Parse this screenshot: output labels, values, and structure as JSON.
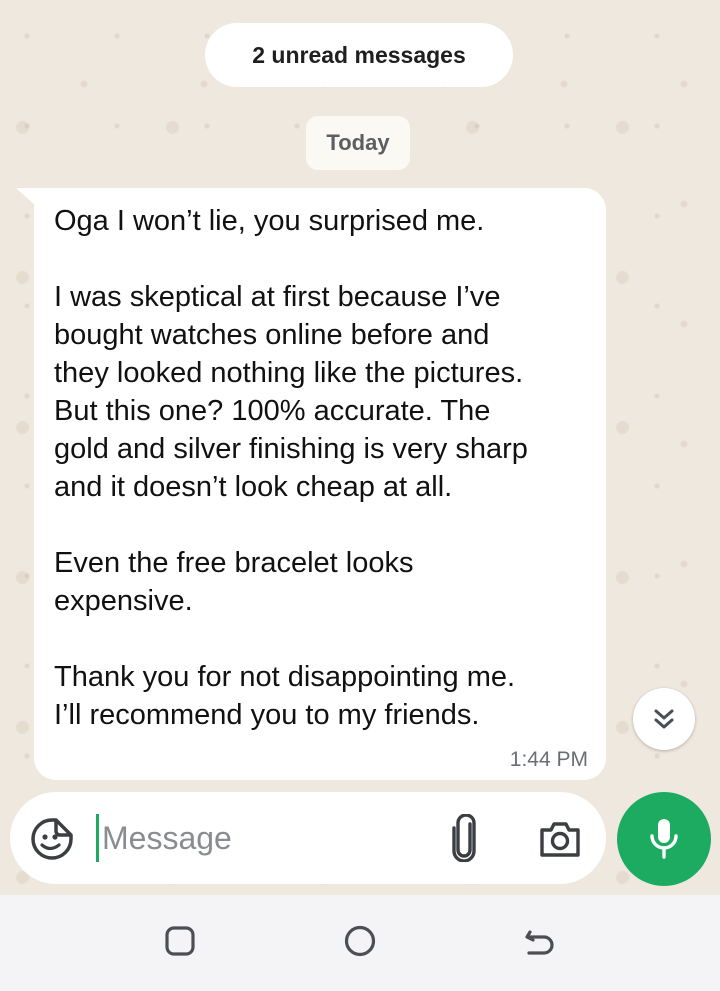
{
  "chat": {
    "unread_label": "2 unread messages",
    "date_label": "Today",
    "message": {
      "paragraphs": [
        "Oga I won’t lie, you surprised me.",
        "I was skeptical at first because I’ve\nbought watches online before and\nthey looked nothing like the pictures.\nBut this one? 100% accurate. The\ngold and silver finishing is very sharp\nand it doesn’t look cheap at all.",
        "Even the free bracelet looks\nexpensive.",
        "Thank you for not disappointing me.\nI’ll recommend you to my friends."
      ],
      "time": "1:44 PM"
    }
  },
  "composer": {
    "placeholder": "Message",
    "value": ""
  },
  "icons": {
    "scroll_down": "double-chevron-down-icon",
    "sticker": "sticker-icon",
    "attach": "paperclip-icon",
    "camera": "camera-icon",
    "mic": "microphone-icon",
    "nav_recents": "recents-icon",
    "nav_home": "home-icon",
    "nav_back": "back-icon"
  },
  "colors": {
    "accent": "#1daa61",
    "bubble": "#ffffff",
    "wallpaper": "#efe8de"
  }
}
